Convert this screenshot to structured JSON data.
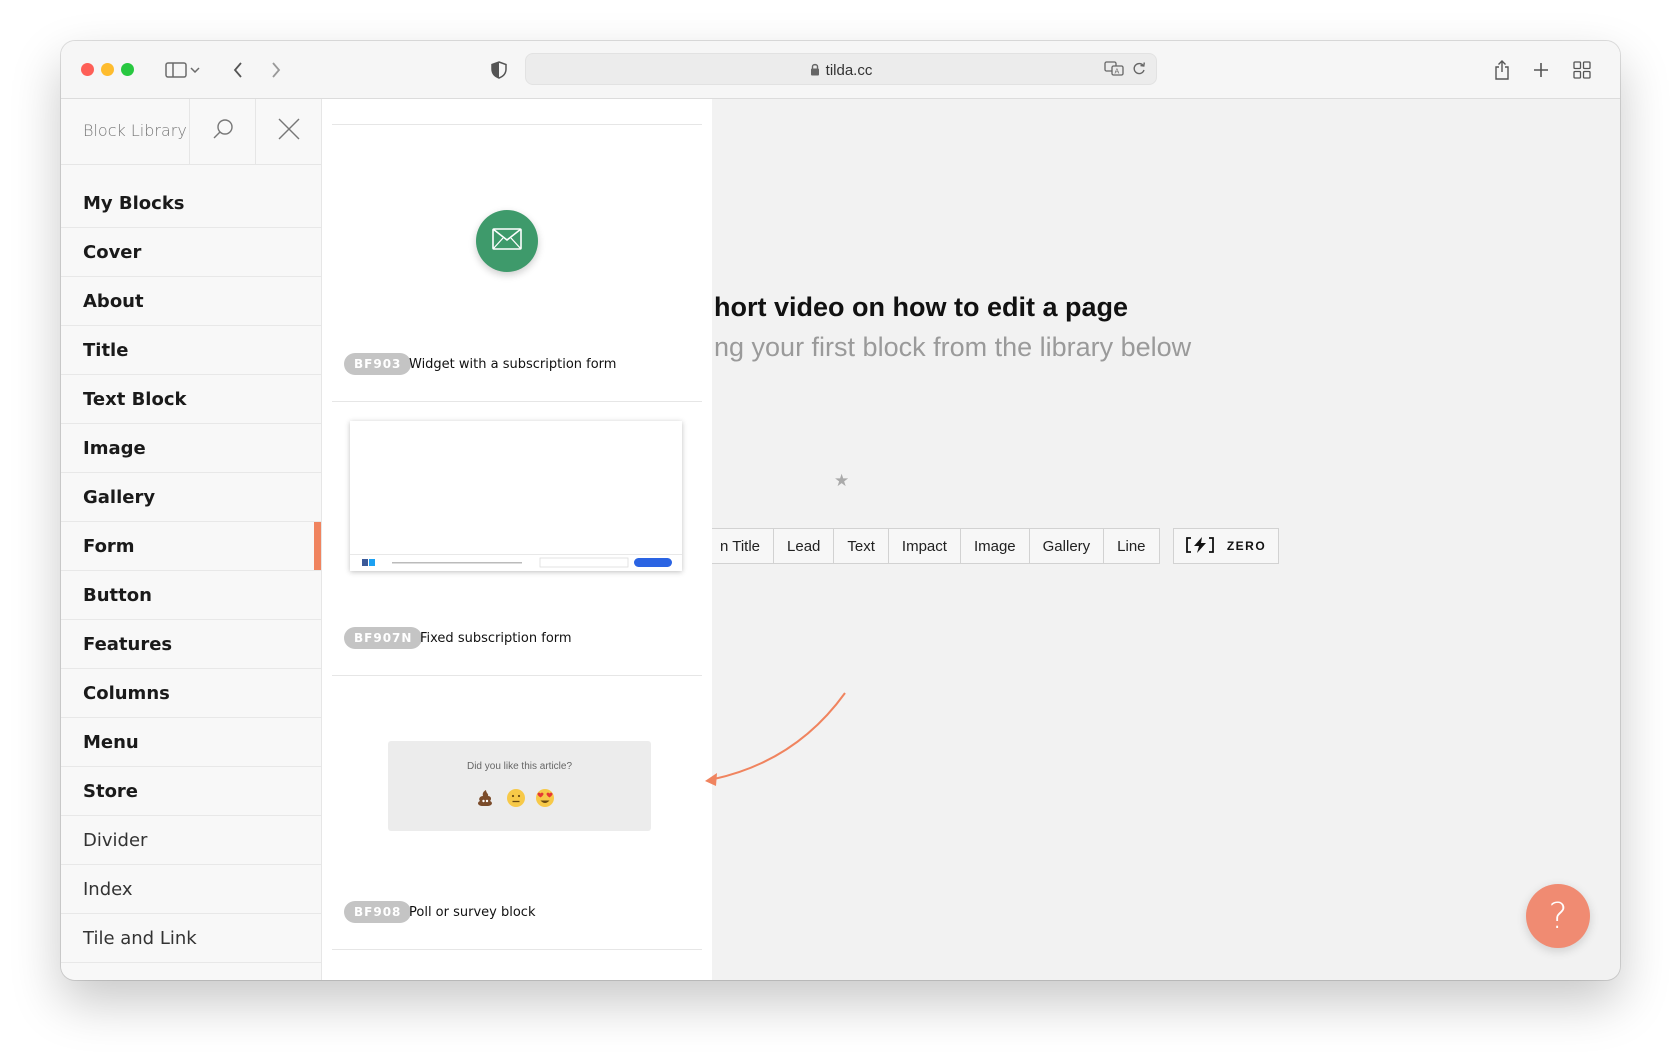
{
  "browser": {
    "url": "tilda.cc"
  },
  "sidebar": {
    "title": "Block Library",
    "items": [
      {
        "label": "My Blocks"
      },
      {
        "label": "Cover"
      },
      {
        "label": "About"
      },
      {
        "label": "Title"
      },
      {
        "label": "Text Block"
      },
      {
        "label": "Image"
      },
      {
        "label": "Gallery"
      },
      {
        "label": "Form"
      },
      {
        "label": "Button"
      },
      {
        "label": "Features"
      },
      {
        "label": "Columns"
      },
      {
        "label": "Menu"
      },
      {
        "label": "Store"
      },
      {
        "label": "Divider"
      },
      {
        "label": "Index"
      },
      {
        "label": "Tile and Link"
      }
    ],
    "active_item": "Form"
  },
  "blocks": [
    {
      "code": "BF903",
      "name": "Widget with a subscription form"
    },
    {
      "code": "BF907N",
      "name": "Fixed subscription form"
    },
    {
      "code": "BF908",
      "name": "Poll or survey block",
      "poll_question": "Did you like this article?"
    }
  ],
  "workspace": {
    "title": "hort video on how to edit a page",
    "subtitle": "ng your first block from the library below",
    "buttons": [
      "n Title",
      "Lead",
      "Text",
      "Impact",
      "Image",
      "Gallery",
      "Line"
    ],
    "zero_label": "ZERO",
    "help_label": "?"
  },
  "colors": {
    "accent": "#f0845f",
    "mail_widget": "#3e9a6b",
    "help_button": "#f08b72"
  }
}
